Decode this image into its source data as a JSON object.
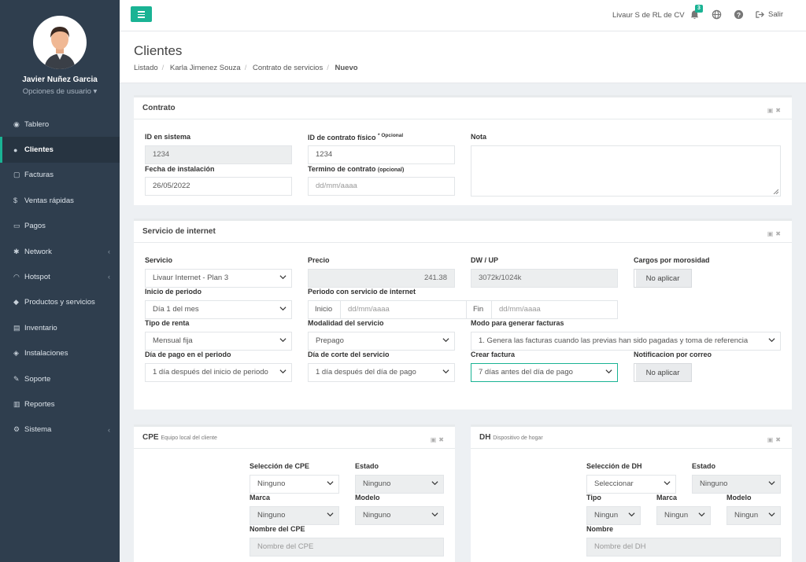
{
  "user": {
    "name": "Javier Nuñez Garcia",
    "options": "Opciones de usuario ▾"
  },
  "sidebar": {
    "items": [
      {
        "icon": "◉",
        "label": "Tablero"
      },
      {
        "icon": "●",
        "label": "Clientes"
      },
      {
        "icon": "▢",
        "label": "Facturas"
      },
      {
        "icon": "$",
        "label": "Ventas rápidas"
      },
      {
        "icon": "▭",
        "label": "Pagos"
      },
      {
        "icon": "✱",
        "label": "Network",
        "chev": "‹"
      },
      {
        "icon": "◠",
        "label": "Hotspot",
        "chev": "‹"
      },
      {
        "icon": "◆",
        "label": "Productos y servicios"
      },
      {
        "icon": "▤",
        "label": "Inventario"
      },
      {
        "icon": "◈",
        "label": "Instalaciones"
      },
      {
        "icon": "✎",
        "label": "Soporte"
      },
      {
        "icon": "▥",
        "label": "Reportes"
      },
      {
        "icon": "⚙",
        "label": "Sistema",
        "chev": "‹"
      }
    ]
  },
  "topbar": {
    "company": "Livaur S de RL de CV",
    "badge": "3",
    "logout": "Salir"
  },
  "page": {
    "title": "Clientes",
    "breadcrumbs": [
      "Listado",
      "Karla Jimenez Souza",
      "Contrato de servicios"
    ],
    "current": "Nuevo"
  },
  "contrato": {
    "title": "Contrato",
    "id_sistema": {
      "label": "ID en sistema",
      "value": "1234"
    },
    "id_fisico": {
      "label": "ID de contrato físico",
      "tag": "* Opcional",
      "value": "1234"
    },
    "nota": {
      "label": "Nota"
    },
    "fecha_inst": {
      "label": "Fecha de instalación",
      "value": "26/05/2022"
    },
    "termino": {
      "label": "Termino de contrato",
      "tag": "(opcional)",
      "placeholder": "dd/mm/aaaa"
    }
  },
  "servicio": {
    "title": "Servicio de internet",
    "servicio": {
      "label": "Servicio",
      "value": "Livaur Internet - Plan 3"
    },
    "precio": {
      "label": "Precio",
      "value": "241.38"
    },
    "dwup": {
      "label": "DW / UP",
      "value": "3072k/1024k"
    },
    "cargos": {
      "label": "Cargos por morosidad",
      "value": "No aplicar"
    },
    "inicio_periodo": {
      "label": "Inicio de periodo",
      "value": "Día 1 del mes"
    },
    "periodo": {
      "label": "Periodo con servicio de internet",
      "inicio": "Inicio",
      "fin": "Fin",
      "placeholder": "dd/mm/aaaa"
    },
    "tipo_renta": {
      "label": "Tipo de renta",
      "value": "Mensual fija"
    },
    "modalidad": {
      "label": "Modalidad del servicio",
      "value": "Prepago"
    },
    "modo_fact": {
      "label": "Modo para generar facturas",
      "value": "1. Genera las facturas cuando las previas han sido pagadas y toma de referencia"
    },
    "dia_pago": {
      "label": "Día de pago en el periodo",
      "value": "1 día después del inicio de periodo"
    },
    "dia_corte": {
      "label": "Día de corte del servicio",
      "value": "1 día después del día de pago"
    },
    "crear_fact": {
      "label": "Crear factura",
      "value": "7 días antes del día de pago"
    },
    "notif": {
      "label": "Notificacion por correo",
      "value": "No aplicar"
    }
  },
  "cpe": {
    "title": "CPE",
    "subtitle": "Equipo local del cliente",
    "seleccion": {
      "label": "Selección de CPE",
      "value": "Ninguno"
    },
    "estado": {
      "label": "Estado",
      "value": "Ninguno"
    },
    "marca": {
      "label": "Marca",
      "value": "Ninguno"
    },
    "modelo": {
      "label": "Modelo",
      "value": "Ninguno"
    },
    "nombre": {
      "label": "Nombre del CPE",
      "placeholder": "Nombre del CPE"
    }
  },
  "dh": {
    "title": "DH",
    "subtitle": "Dispositivo de hogar",
    "seleccion": {
      "label": "Selección de DH",
      "value": "Seleccionar"
    },
    "estado": {
      "label": "Estado",
      "value": "Ninguno"
    },
    "tipo": {
      "label": "Tipo",
      "value": "Ningun"
    },
    "marca": {
      "label": "Marca",
      "value": "Ningun"
    },
    "modelo": {
      "label": "Modelo",
      "value": "Ningun"
    },
    "nombre": {
      "label": "Nombre",
      "placeholder": "Nombre del DH"
    }
  },
  "colors": {
    "accent": "#1ab394",
    "sidebar": "#2f3e4e",
    "sidebar_active": "#273441"
  },
  "icons": [
    "menu-icon",
    "bell-icon",
    "globe-icon",
    "help-icon",
    "logout-icon",
    "save-icon",
    "close-icon",
    "chevron-down-icon"
  ]
}
